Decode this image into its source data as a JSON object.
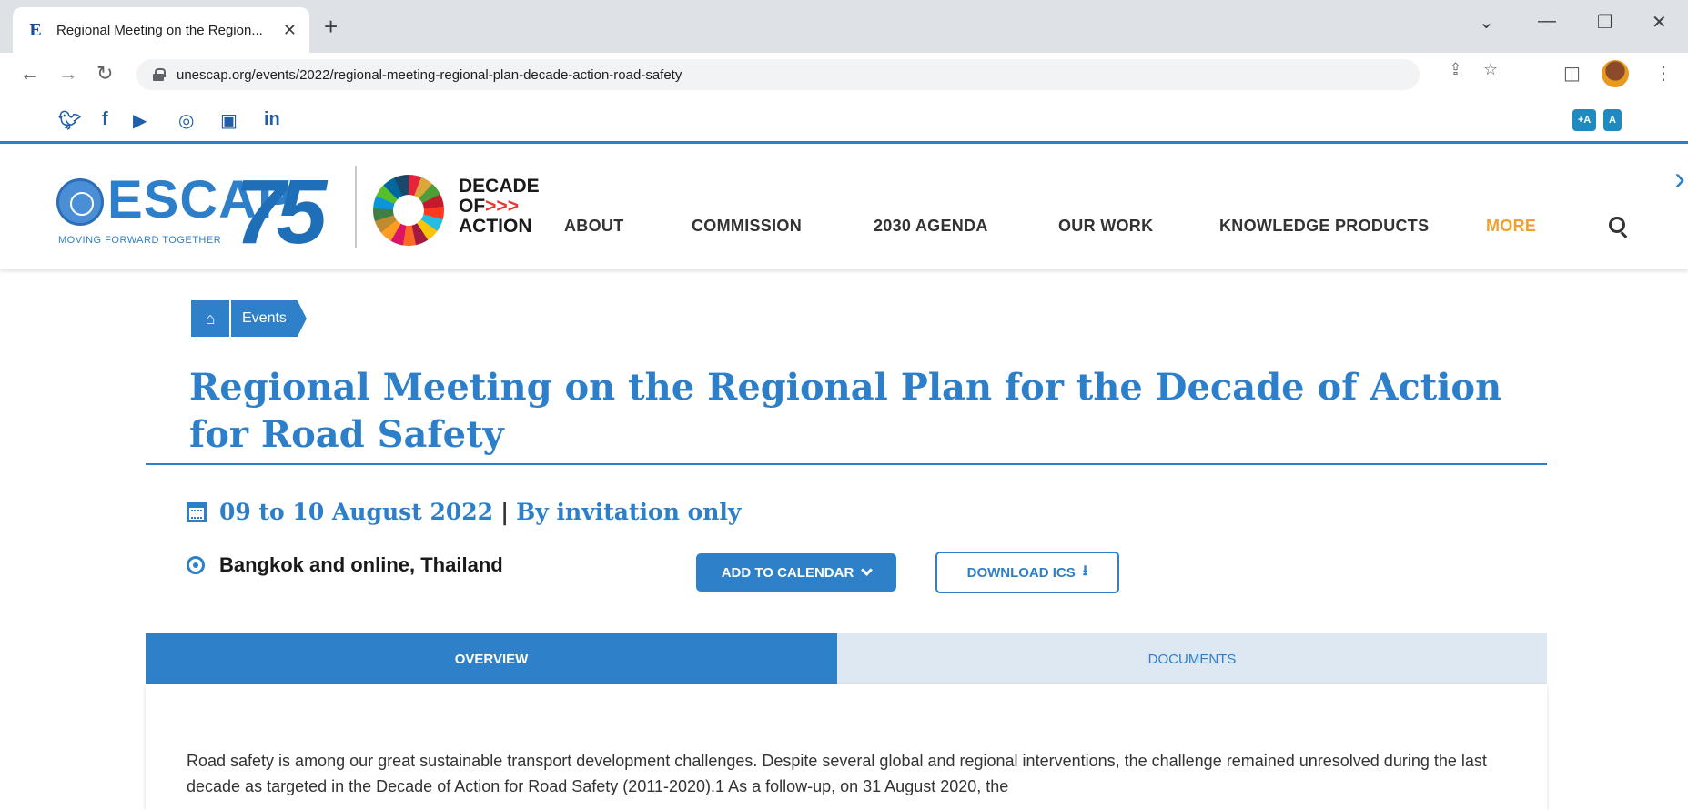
{
  "browser": {
    "tab_title": "Regional Meeting on the Region...",
    "favicon_letter": "E",
    "url": "unescap.org/events/2022/regional-meeting-regional-plan-decade-action-road-safety"
  },
  "header": {
    "social": [
      "twitter",
      "facebook",
      "youtube",
      "instagram",
      "flickr",
      "linkedin"
    ],
    "logo_text": "ESCAP",
    "logo_number": "75",
    "logo_tagline": "MOVING FORWARD TOGETHER",
    "decade_line1": "DECADE",
    "decade_line2": "OF",
    "decade_arrows": ">>>",
    "decade_line3": "ACTION",
    "nav": [
      "ABOUT",
      "COMMISSION",
      "2030 AGENDA",
      "OUR WORK",
      "KNOWLEDGE PRODUCTS",
      "MORE"
    ],
    "accent_color": "#2e80c8",
    "more_color": "#f0a030"
  },
  "breadcrumb": {
    "home_icon": "home-icon",
    "current": "Events"
  },
  "event": {
    "title": "Regional Meeting on the Regional Plan for the Decade of Action for Road Safety",
    "date": "09 to 10 August 2022",
    "separator": "|",
    "access": "By invitation only",
    "location": "Bangkok and online, Thailand",
    "add_calendar_label": "ADD TO CALENDAR",
    "download_ics_label": "DOWNLOAD ICS"
  },
  "tabs": {
    "overview": "OVERVIEW",
    "documents": "DOCUMENTS"
  },
  "overview": {
    "text": "Road safety is among our great sustainable transport development challenges. Despite several global and regional interventions, the challenge remained unresolved during the last decade as targeted in the Decade of Action for Road Safety (2011-2020).1  As a follow-up, on 31 August 2020, the"
  }
}
